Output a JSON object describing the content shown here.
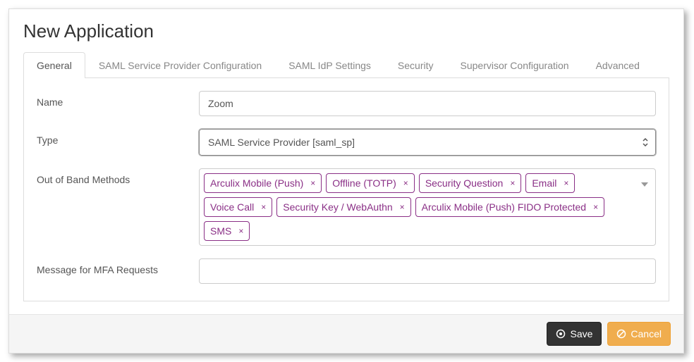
{
  "page_title": "New Application",
  "tabs": [
    {
      "label": "General",
      "active": true
    },
    {
      "label": "SAML Service Provider Configuration",
      "active": false
    },
    {
      "label": "SAML IdP Settings",
      "active": false
    },
    {
      "label": "Security",
      "active": false
    },
    {
      "label": "Supervisor Configuration",
      "active": false
    },
    {
      "label": "Advanced",
      "active": false
    }
  ],
  "form": {
    "name": {
      "label": "Name",
      "value": "Zoom"
    },
    "type": {
      "label": "Type",
      "selected": "SAML Service Provider [saml_sp]"
    },
    "oob": {
      "label": "Out of Band Methods",
      "tags": [
        "Arculix Mobile (Push)",
        "Offline (TOTP)",
        "Security Question",
        "Email",
        "Voice Call",
        "Security Key / WebAuthn",
        "Arculix Mobile (Push) FIDO Protected",
        "SMS"
      ]
    },
    "mfa_message": {
      "label": "Message for MFA Requests",
      "value": ""
    }
  },
  "buttons": {
    "save": "Save",
    "cancel": "Cancel"
  },
  "colors": {
    "tag_border": "#8a2f86",
    "save_bg": "#333333",
    "cancel_bg": "#f0ad4e"
  }
}
